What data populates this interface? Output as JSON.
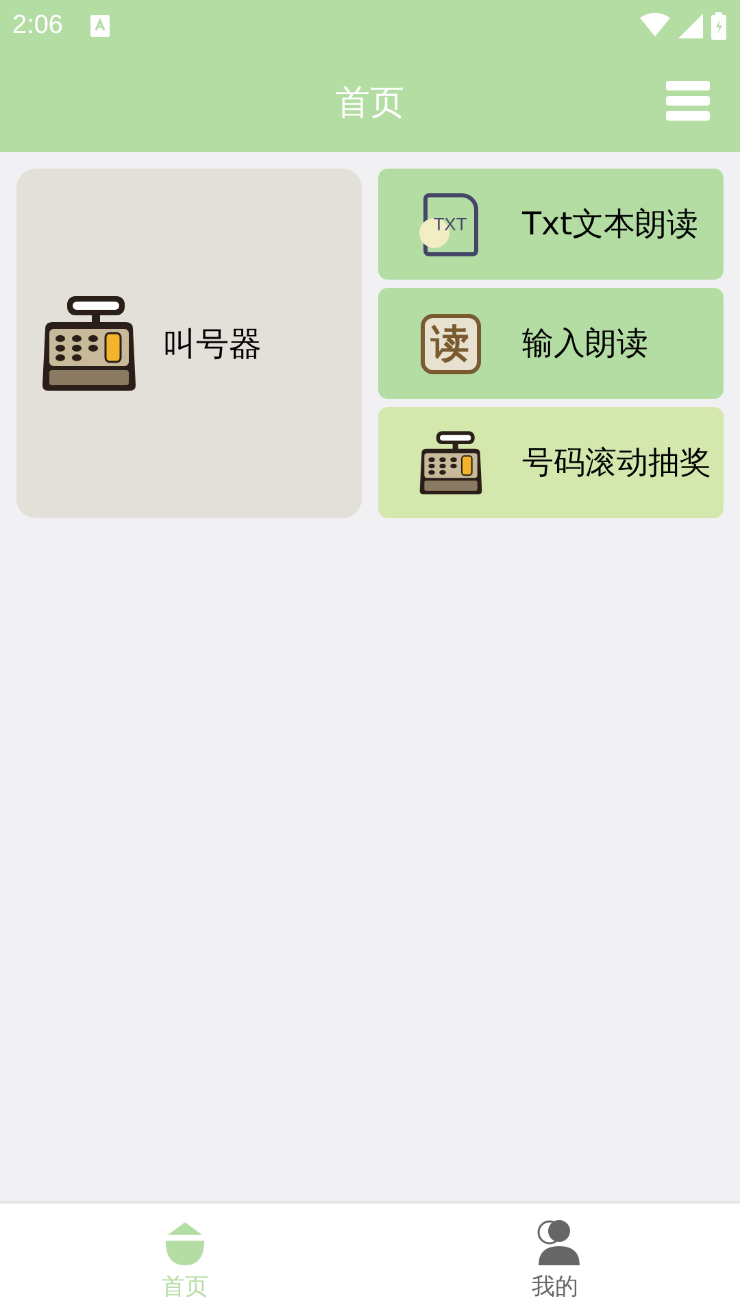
{
  "status_bar": {
    "time": "2:06"
  },
  "app_bar": {
    "title": "首页"
  },
  "tiles": [
    {
      "label": "叫号器",
      "kind": "register-large",
      "color": "#e3e0d9"
    },
    {
      "label": "Txt文本朗读",
      "kind": "txt",
      "icon_text": "TXT",
      "color": "#b4dda4"
    },
    {
      "label": "输入朗读",
      "kind": "read",
      "icon_text": "读",
      "color": "#b4dda4"
    },
    {
      "label": "号码滚动抽奖",
      "kind": "register",
      "color": "#d4e8ae"
    }
  ],
  "bottom_nav": [
    {
      "label": "首页",
      "kind": "home",
      "selected": true
    },
    {
      "label": "我的",
      "kind": "person",
      "selected": false
    }
  ]
}
